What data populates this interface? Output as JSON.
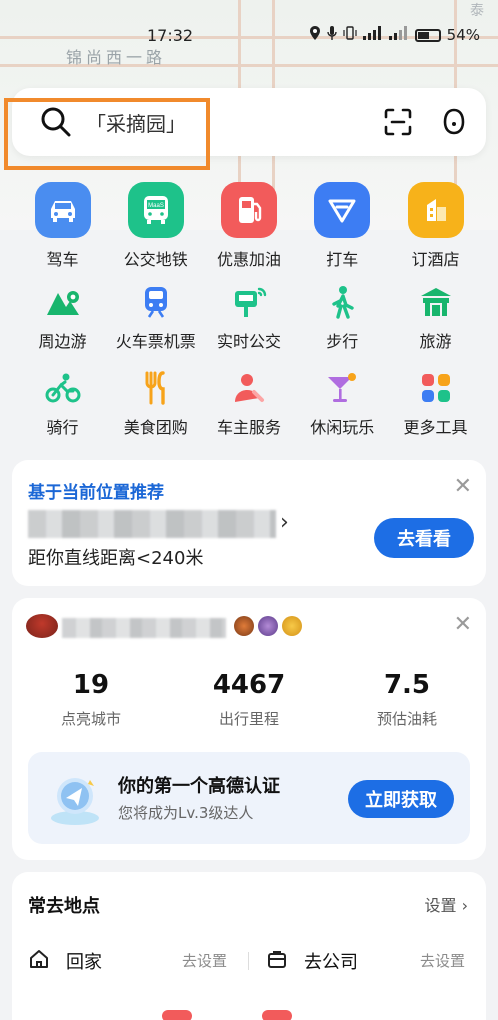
{
  "status_bar": {
    "time": "17:32",
    "battery": "54%"
  },
  "map": {
    "street": "锦尚西一路",
    "corner": "泰"
  },
  "search": {
    "placeholder": "「采摘园」"
  },
  "grid": {
    "row1": [
      {
        "label": "驾车",
        "color": "#4a8df0"
      },
      {
        "label": "公交地铁",
        "color": "#1ec28a"
      },
      {
        "label": "优惠加油",
        "color": "#f25b5b"
      },
      {
        "label": "打车",
        "color": "#3d7df3"
      },
      {
        "label": "订酒店",
        "color": "#f7b21a"
      }
    ],
    "row2": [
      {
        "label": "周边游",
        "color": "#18b56d"
      },
      {
        "label": "火车票机票",
        "color": "#3d7df3"
      },
      {
        "label": "实时公交",
        "color": "#1ec28a"
      },
      {
        "label": "步行",
        "color": "#1ec28a"
      },
      {
        "label": "旅游",
        "color": "#18b56d"
      }
    ],
    "row3": [
      {
        "label": "骑行",
        "color": "#1ec28a"
      },
      {
        "label": "美食团购",
        "color": "#f7a31a"
      },
      {
        "label": "车主服务",
        "color": "#f25b5b"
      },
      {
        "label": "休闲玩乐",
        "color": "#b06de0"
      },
      {
        "label": "更多工具",
        "color": "#3d7df3"
      }
    ]
  },
  "recommend": {
    "title": "基于当前位置推荐",
    "distance": "距你直线距离<240米",
    "button": "去看看"
  },
  "profile": {
    "stats": [
      {
        "value": "19",
        "label": "点亮城市"
      },
      {
        "value": "4467",
        "label": "出行里程"
      },
      {
        "value": "7.5",
        "label": "预估油耗"
      }
    ],
    "cert_title": "你的第一个高德认证",
    "cert_sub": "您将成为Lv.3级达人",
    "cert_button": "立即获取"
  },
  "places": {
    "title": "常去地点",
    "setting": "设置",
    "home": "回家",
    "home_set": "去设置",
    "work": "去公司",
    "work_set": "去设置"
  }
}
